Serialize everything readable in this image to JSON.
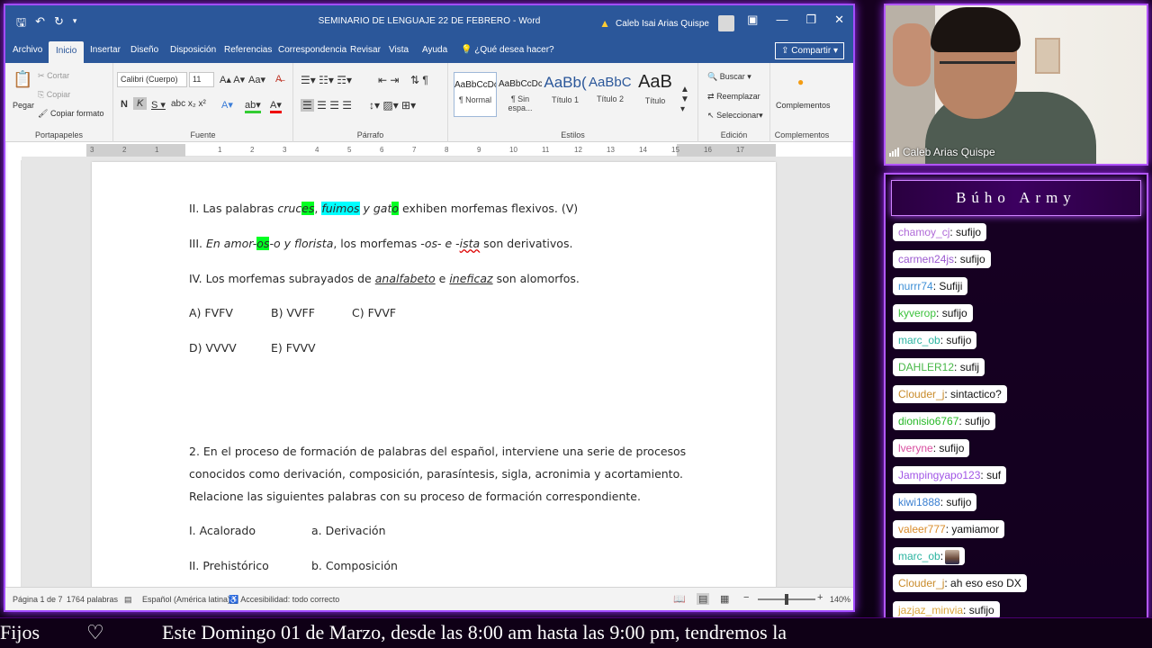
{
  "word": {
    "title": "SEMINARIO DE LENGUAJE 22 DE FEBRERO  -  Word",
    "user": "Caleb Isai Arias Quispe",
    "tabs": [
      "Archivo",
      "Inicio",
      "Insertar",
      "Diseño",
      "Disposición",
      "Referencias",
      "Correspondencia",
      "Revisar",
      "Vista",
      "Ayuda",
      "¿Qué desea hacer?"
    ],
    "share_label": "Compartir",
    "ribbon": {
      "paste": "Pegar",
      "cut": "Cortar",
      "copy": "Copiar",
      "format_painter": "Copiar formato",
      "clipboard_group": "Portapapeles",
      "font_name": "Calibri (Cuerpo)",
      "font_size": "11",
      "font_group": "Fuente",
      "paragraph_group": "Párrafo",
      "styles": [
        {
          "sample": "AaBbCcDc",
          "name": "¶ Normal"
        },
        {
          "sample": "AaBbCcDc",
          "name": "¶ Sin espa..."
        },
        {
          "sample": "AaBb(",
          "name": "Título 1"
        },
        {
          "sample": "AaBbCc",
          "name": "Título 2"
        },
        {
          "sample": "AaB",
          "name": "Título"
        }
      ],
      "styles_group": "Estilos",
      "find": "Buscar",
      "replace": "Reemplazar",
      "select": "Seleccionar",
      "editing_group": "Edición",
      "addins": "Complementos",
      "addins_group": "Complementos"
    },
    "document": {
      "line_ii": {
        "p1": "II. Las palabras ",
        "w1a": "cruc",
        "w1b": "es",
        "p2": ", ",
        "w2": "fuimos",
        "p3": " y ",
        "w3a": "gat",
        "w3b": "o",
        "p4": " exhiben morfemas flexivos.  (V)"
      },
      "line_iii": {
        "p1": "III. ",
        "w1a": "En amor-",
        "w1b": "os",
        "w1c": "-o y florista",
        "p2": ", los morfemas -",
        "w2": "os",
        "p3": "- ",
        "w3": "e",
        "p4": " -",
        "w4": "ista",
        "p5": " son derivativos."
      },
      "line_iv": {
        "p1": "IV. Los morfemas subrayados de ",
        "w1": "analfabeto",
        "p2": " e ",
        "w2": "ineficaz",
        "p3": " son alomorfos."
      },
      "options_row1": [
        "A) FVFV",
        "B) VVFF",
        "C) FVVF"
      ],
      "options_row2": [
        "D) VVVV",
        "E) FVVV"
      ],
      "q2_lines": [
        "2. En el proceso de formación de palabras del español, interviene una serie de procesos",
        "conocidos como derivación, composición, parasíntesis, sigla, acronimia y acortamiento.",
        "Relacione las siguientes palabras con su proceso de formación correspondiente."
      ],
      "match_rows": [
        {
          "left": "I. Acalorado",
          "right": "a. Derivación"
        },
        {
          "left": "II. Prehistórico",
          "right": "b. Composición"
        }
      ]
    },
    "ruler_numbers": [
      "3",
      "2",
      "1",
      "1",
      "2",
      "3",
      "4",
      "5",
      "6",
      "7",
      "8",
      "9",
      "10",
      "11",
      "12",
      "13",
      "14",
      "15",
      "16",
      "17"
    ],
    "status": {
      "page": "Página 1 de 7",
      "words": "1764 palabras",
      "language": "Español (América latina)",
      "accessibility": "Accesibilidad: todo correcto",
      "zoom": "140%"
    }
  },
  "cam": {
    "name": "Caleb Arias Quispe"
  },
  "chat": {
    "title": "Búho Army",
    "messages": [
      {
        "user": "chamoy_cj",
        "text": ": sufijo",
        "color": "#b06ad8"
      },
      {
        "user": "carmen24js",
        "text": ": sufijo",
        "color": "#9b59d0"
      },
      {
        "user": "nurrr74",
        "text": ": Sufiji",
        "color": "#3d8fd6"
      },
      {
        "user": "kyverop",
        "text": ": sufijo",
        "color": "#3cc23c"
      },
      {
        "user": "marc_ob",
        "text": ": sufijo",
        "color": "#2ab3a0"
      },
      {
        "user": "DAHLER12",
        "text": ": sufij",
        "color": "#47b847"
      },
      {
        "user": "Clouder_j",
        "text": ": sintactico?",
        "color": "#c98b2a"
      },
      {
        "user": "dionisio6767",
        "text": ": sufijo",
        "color": "#26b826"
      },
      {
        "user": "lveryne",
        "text": ": sufijo",
        "color": "#d94fa0"
      },
      {
        "user": "Jampingyapo123",
        "text": ": suf",
        "color": "#a155e6"
      },
      {
        "user": "kiwi1888",
        "text": ": sufijo",
        "color": "#3a7fd1"
      },
      {
        "user": "valeer777",
        "text": ": yamiamor",
        "color": "#d98c2a"
      },
      {
        "user": "marc_ob",
        "text": ":",
        "color": "#2ab3a0",
        "emote": true
      },
      {
        "user": "Clouder_j",
        "text": ": ah eso eso DX",
        "color": "#c98b2a"
      },
      {
        "user": "jazjaz_minvia",
        "text": ": sufijo",
        "color": "#d9a53c"
      }
    ]
  },
  "ticker": {
    "left": "Fijos",
    "heart": "♡",
    "text": "Este Domingo 01 de Marzo, desde las 8:00 am hasta las 9:00 pm, tendremos la"
  }
}
